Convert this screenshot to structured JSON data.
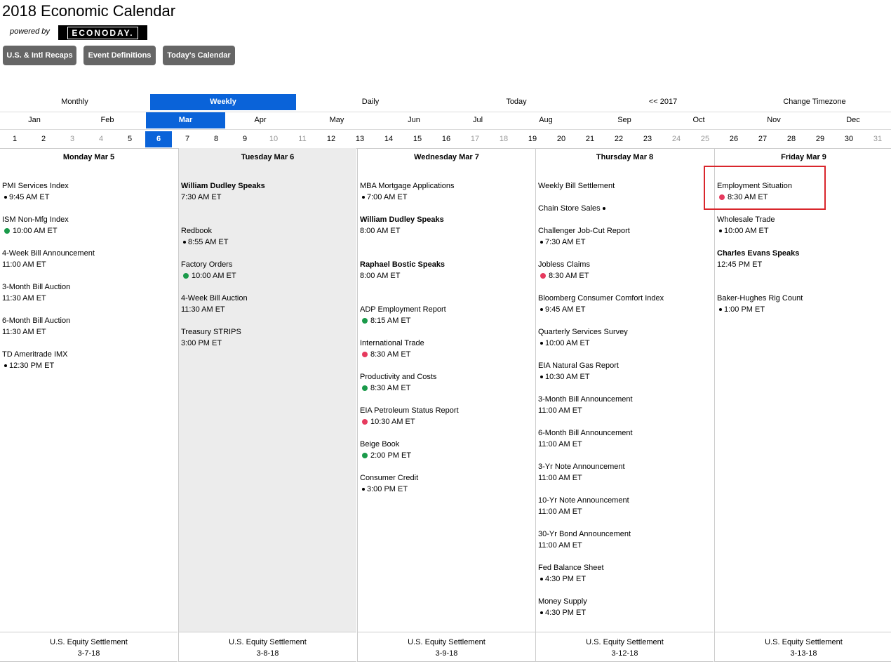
{
  "page": {
    "title": "2018 Economic Calendar",
    "powered_by": "powered by",
    "logo": "ECONODAY."
  },
  "top_buttons": [
    "U.S. & Intl Recaps",
    "Event Definitions",
    "Today's Calendar"
  ],
  "nav": [
    "Monthly",
    "Weekly",
    "Daily",
    "Today",
    "<< 2017",
    "Change Timezone"
  ],
  "nav_active": "Weekly",
  "months": [
    "Jan",
    "Feb",
    "Mar",
    "Apr",
    "May",
    "Jun",
    "Jul",
    "Aug",
    "Sep",
    "Oct",
    "Nov",
    "Dec"
  ],
  "month_active": "Mar",
  "days": [
    "1",
    "2",
    "3",
    "4",
    "5",
    "6",
    "7",
    "8",
    "9",
    "10",
    "11",
    "12",
    "13",
    "14",
    "15",
    "16",
    "17",
    "18",
    "19",
    "20",
    "21",
    "22",
    "23",
    "24",
    "25",
    "26",
    "27",
    "28",
    "29",
    "30",
    "31"
  ],
  "day_active": "6",
  "weekend_days": [
    "3",
    "4",
    "10",
    "11",
    "17",
    "18",
    "24",
    "25",
    "31"
  ],
  "colors": {
    "accent": "#0a63d9",
    "high_impact": "#e63a5e",
    "medium_impact": "#1a9a4a",
    "highlight": "#d9262c"
  },
  "columns": [
    {
      "header": "Monday Mar 5",
      "events": [
        {
          "name": "PMI Services Index",
          "time": "9:45 AM ET",
          "dot": "black"
        },
        {
          "name": "ISM Non-Mfg Index",
          "time": "10:00 AM ET",
          "dot": "green"
        },
        {
          "name": "4-Week Bill Announcement",
          "time": "11:00 AM ET",
          "dot": "none"
        },
        {
          "name": "3-Month Bill Auction",
          "time": "11:30 AM ET",
          "dot": "none"
        },
        {
          "name": "6-Month Bill Auction",
          "time": "11:30 AM ET",
          "dot": "none"
        },
        {
          "name": "TD Ameritrade IMX",
          "time": "12:30 PM ET",
          "dot": "black"
        }
      ],
      "footer": {
        "label": "U.S. Equity Settlement",
        "date": "3-7-18"
      }
    },
    {
      "header": "Tuesday Mar 6",
      "events": [
        {
          "name": "William Dudley Speaks",
          "time": "7:30 AM ET",
          "dot": "none",
          "bold": true
        },
        {
          "name": "Redbook",
          "time": "8:55 AM ET",
          "dot": "black"
        },
        {
          "name": "Factory Orders",
          "time": "10:00 AM ET",
          "dot": "green"
        },
        {
          "name": "4-Week Bill Auction",
          "time": "11:30 AM ET",
          "dot": "none"
        },
        {
          "name": "Treasury STRIPS",
          "time": "3:00 PM ET",
          "dot": "none"
        }
      ],
      "footer": {
        "label": "U.S. Equity Settlement",
        "date": "3-8-18"
      }
    },
    {
      "header": "Wednesday Mar 7",
      "events": [
        {
          "name": "MBA Mortgage Applications",
          "time": "7:00 AM ET",
          "dot": "black"
        },
        {
          "name": "William Dudley Speaks",
          "time": "8:00 AM ET",
          "dot": "none",
          "bold": true
        },
        {
          "name": "Raphael Bostic Speaks",
          "time": "8:00 AM ET",
          "dot": "none",
          "bold": true
        },
        {
          "name": "ADP Employment Report",
          "time": "8:15 AM ET",
          "dot": "green"
        },
        {
          "name": "International Trade",
          "time": "8:30 AM ET",
          "dot": "red"
        },
        {
          "name": "Productivity and Costs",
          "time": "8:30 AM ET",
          "dot": "green"
        },
        {
          "name": "EIA Petroleum Status Report",
          "time": "10:30 AM ET",
          "dot": "red"
        },
        {
          "name": "Beige Book",
          "time": "2:00 PM ET",
          "dot": "green"
        },
        {
          "name": "Consumer Credit",
          "time": "3:00 PM ET",
          "dot": "black"
        }
      ],
      "footer": {
        "label": "U.S. Equity Settlement",
        "date": "3-9-18"
      }
    },
    {
      "header": "Thursday Mar 8",
      "events": [
        {
          "name": "Weekly Bill Settlement",
          "time": "",
          "dot": "none"
        },
        {
          "name": "Chain Store Sales",
          "time": "",
          "dot": "none",
          "name_dot": true
        },
        {
          "name": "Challenger Job-Cut Report",
          "time": "7:30 AM ET",
          "dot": "black"
        },
        {
          "name": "Jobless Claims",
          "time": "8:30 AM ET",
          "dot": "red"
        },
        {
          "name": "Bloomberg Consumer Comfort Index",
          "time": "9:45 AM ET",
          "dot": "black"
        },
        {
          "name": "Quarterly Services Survey",
          "time": "10:00 AM ET",
          "dot": "black"
        },
        {
          "name": "EIA Natural Gas Report",
          "time": "10:30 AM ET",
          "dot": "black"
        },
        {
          "name": "3-Month Bill Announcement",
          "time": "11:00 AM ET",
          "dot": "none"
        },
        {
          "name": "6-Month Bill Announcement",
          "time": "11:00 AM ET",
          "dot": "none"
        },
        {
          "name": "3-Yr Note Announcement",
          "time": "11:00 AM ET",
          "dot": "none"
        },
        {
          "name": "10-Yr Note Announcement",
          "time": "11:00 AM ET",
          "dot": "none"
        },
        {
          "name": "30-Yr Bond Announcement",
          "time": "11:00 AM ET",
          "dot": "none"
        },
        {
          "name": "Fed Balance Sheet",
          "time": "4:30 PM ET",
          "dot": "black"
        },
        {
          "name": "Money Supply",
          "time": "4:30 PM ET",
          "dot": "black"
        }
      ],
      "footer": {
        "label": "U.S. Equity Settlement",
        "date": "3-12-18"
      }
    },
    {
      "header": "Friday Mar 9",
      "events": [
        {
          "name": "Employment Situation",
          "time": "8:30 AM ET",
          "dot": "red"
        },
        {
          "name": "Wholesale Trade",
          "time": "10:00 AM ET",
          "dot": "black"
        },
        {
          "name": "Charles Evans Speaks",
          "time": "12:45 PM ET",
          "dot": "none",
          "bold": true
        },
        {
          "name": "Baker-Hughes Rig Count",
          "time": "1:00 PM ET",
          "dot": "black"
        }
      ],
      "footer": {
        "label": "U.S. Equity Settlement",
        "date": "3-13-18"
      }
    }
  ]
}
